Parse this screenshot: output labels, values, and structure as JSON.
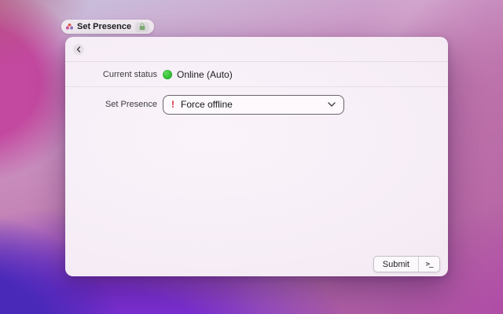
{
  "title_bar": {
    "title": "Set Presence"
  },
  "panel": {
    "current_status": {
      "label": "Current status",
      "value": "Online (Auto)"
    },
    "set_presence": {
      "label": "Set Presence",
      "selected_option": "Force offline",
      "warning_glyph": "!"
    },
    "footer": {
      "submit_label": "Submit",
      "terminal_glyph": ">_"
    }
  },
  "icons": {
    "favicon": "flower-favicon-icon",
    "lock": "lock-icon",
    "back": "chevron-left-icon",
    "dropdown": "chevron-down-icon",
    "terminal": "terminal-prompt-icon"
  },
  "colors": {
    "status_online": "#2fbe31",
    "warning_red": "#d62a3c",
    "window_bg": "#f6edf6",
    "wallpaper_purple": "#7a2fd2",
    "wallpaper_magenta": "#c3489f"
  }
}
